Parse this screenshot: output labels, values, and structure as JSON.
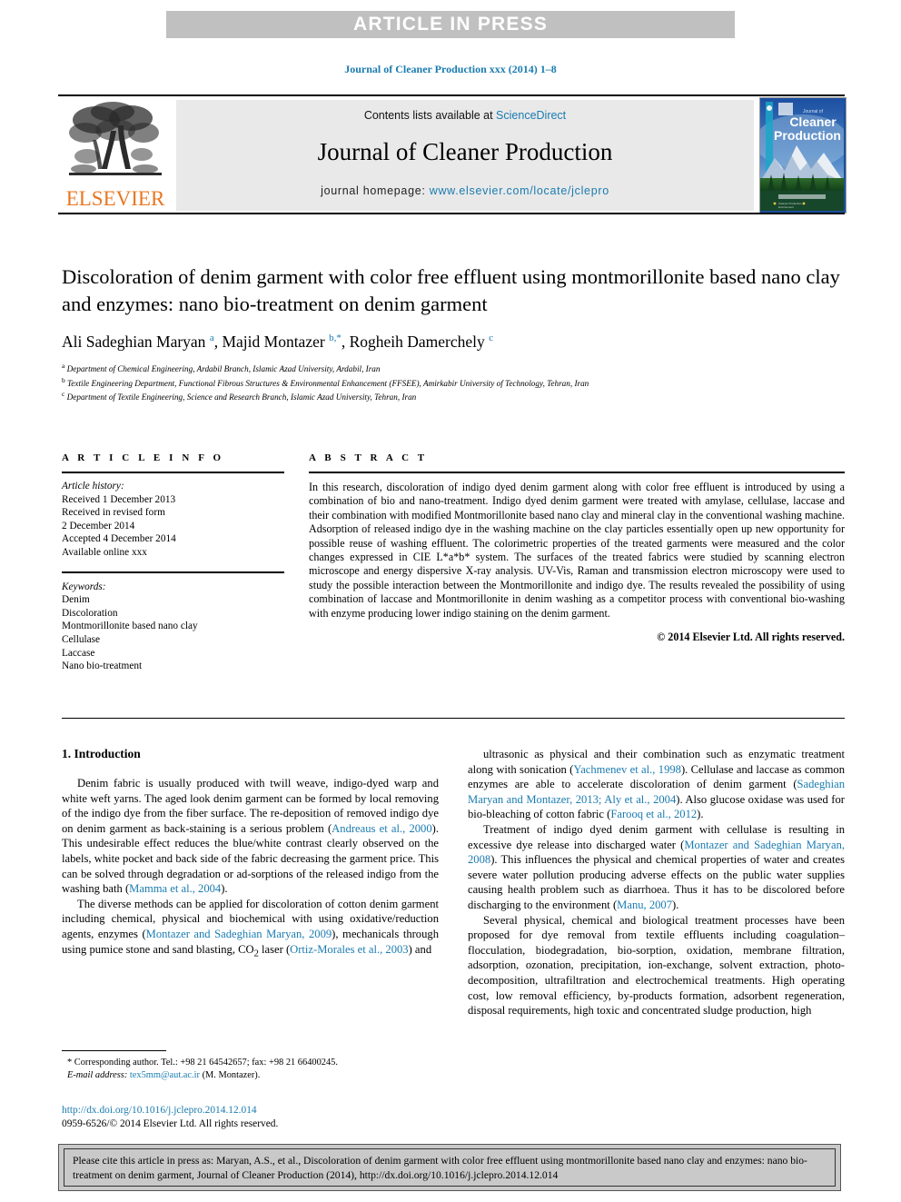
{
  "banner": {
    "text": "ARTICLE IN PRESS"
  },
  "running_head": "Journal of Cleaner Production xxx (2014) 1–8",
  "masthead": {
    "contents_prefix": "Contents lists available at ",
    "sciencedirect": "ScienceDirect",
    "journal_title": "Journal of Cleaner Production",
    "homepage_label": "journal homepage: ",
    "homepage_url": "www.elsevier.com/locate/jclepro",
    "publisher": "ELSEVIER",
    "cover_line1": "Journal of",
    "cover_line2": "Cleaner",
    "cover_line3": "Production",
    "accent_color": "#1a7bb0",
    "publisher_color": "#e87722"
  },
  "article": {
    "title": "Discoloration of denim garment with color free effluent using montmorillonite based nano clay and enzymes: nano bio-treatment on denim garment",
    "authors_html": "Ali Sadeghian Maryan <sup>a</sup>, Majid Montazer <sup>b,</sup><sup>*</sup>, Rogheih Damerchely <sup>c</sup>",
    "affiliations": [
      {
        "mark": "a",
        "text": "Department of Chemical Engineering, Ardabil Branch, Islamic Azad University, Ardabil, Iran"
      },
      {
        "mark": "b",
        "text": "Textile Engineering Department, Functional Fibrous Structures & Environmental Enhancement (FFSEE), Amirkabir University of Technology, Tehran, Iran"
      },
      {
        "mark": "c",
        "text": "Department of Textile Engineering, Science and Research Branch, Islamic Azad University, Tehran, Iran"
      }
    ]
  },
  "article_info": {
    "heading": "A R T I C L E  I N F O",
    "history_label": "Article history:",
    "history_lines": [
      "Received 1 December 2013",
      "Received in revised form",
      "2 December 2014",
      "Accepted 4 December 2014",
      "Available online xxx"
    ],
    "keywords_label": "Keywords:",
    "keywords": [
      "Denim",
      "Discoloration",
      "Montmorillonite based nano clay",
      "Cellulase",
      "Laccase",
      "Nano bio-treatment"
    ]
  },
  "abstract": {
    "heading": "A B S T R A C T",
    "text": "In this research, discoloration of indigo dyed denim garment along with color free effluent is introduced by using a combination of bio and nano-treatment. Indigo dyed denim garment were treated with amylase, cellulase, laccase and their combination with modified Montmorillonite based nano clay and mineral clay in the conventional washing machine. Adsorption of released indigo dye in the washing machine on the clay particles essentially open up new opportunity for possible reuse of washing effluent. The colorimetric properties of the treated garments were measured and the color changes expressed in CIE L*a*b* system. The surfaces of the treated fabrics were studied by scanning electron microscope and energy dispersive X-ray analysis. UV-Vis, Raman and transmission electron microscopy were used to study the possible interaction between the Montmorillonite and indigo dye. The results revealed the possibility of using combination of laccase and Montmorillonite in denim washing as a competitor process with conventional bio-washing with enzyme producing lower indigo staining on the denim garment.",
    "copyright": "© 2014 Elsevier Ltd. All rights reserved."
  },
  "introduction": {
    "section_number_title": "1. Introduction",
    "left_paragraphs": [
      "Denim fabric is usually produced with twill weave, indigo-dyed warp and white weft yarns. The aged look denim garment can be formed by local removing of the indigo dye from the fiber surface. The re-deposition of removed indigo dye on denim garment as back-staining is a serious problem (<span class=\"ref\" data-name=\"citation-link\" data-interactable=\"true\">Andreaus et al., 2000</span>). This undesirable effect reduces the blue/white contrast clearly observed on the labels, white pocket and back side of the fabric decreasing the garment price. This can be solved through degradation or ad-sorptions of the released indigo from the washing bath (<span class=\"ref\" data-name=\"citation-link\" data-interactable=\"true\">Mamma et al., 2004</span>).",
      "The diverse methods can be applied for discoloration of cotton denim garment including chemical, physical and biochemical with using oxidative/reduction agents, enzymes (<span class=\"ref\" data-name=\"citation-link\" data-interactable=\"true\">Montazer and Sadeghian Maryan, 2009</span>), mechanicals through using pumice stone and sand blasting, CO<sub>2</sub> laser (<span class=\"ref\" data-name=\"citation-link\" data-interactable=\"true\">Ortiz-Morales et al., 2003</span>) and"
    ],
    "right_paragraphs": [
      "ultrasonic as physical and their combination such as enzymatic treatment along with sonication (<span class=\"ref\" data-name=\"citation-link\" data-interactable=\"true\">Yachmenev et al., 1998</span>). Cellulase and laccase as common enzymes are able to accelerate discoloration of denim garment (<span class=\"ref\" data-name=\"citation-link\" data-interactable=\"true\">Sadeghian Maryan and Montazer, 2013; Aly et al., 2004</span>). Also glucose oxidase was used for bio-bleaching of cotton fabric (<span class=\"ref\" data-name=\"citation-link\" data-interactable=\"true\">Farooq et al., 2012</span>).",
      "Treatment of indigo dyed denim garment with cellulase is resulting in excessive dye release into discharged water (<span class=\"ref\" data-name=\"citation-link\" data-interactable=\"true\">Montazer and Sadeghian Maryan, 2008</span>). This influences the physical and chemical properties of water and creates severe water pollution producing adverse effects on the public water supplies causing health problem such as diarrhoea. Thus it has to be discolored before discharging to the environment (<span class=\"ref\" data-name=\"citation-link\" data-interactable=\"true\">Manu, 2007</span>).",
      "Several physical, chemical and biological treatment processes have been proposed for dye removal from textile effluents including coagulation–flocculation, biodegradation, bio-sorption, oxidation, membrane filtration, adsorption, ozonation, precipitation, ion-exchange, solvent extraction, photo-decomposition, ultrafiltration and electrochemical treatments. High operating cost, low removal efficiency, by-products formation, adsorbent regeneration, disposal requirements, high toxic and concentrated sludge production, high"
    ]
  },
  "footnote": {
    "corresponding": "* Corresponding author. Tel.: +98 21 64542657; fax: +98 21 66400245.",
    "email_label": "E-mail address:",
    "email": "tex5mm@aut.ac.ir",
    "email_owner": "(M. Montazer)."
  },
  "doi_block": {
    "doi_url": "http://dx.doi.org/10.1016/j.jclepro.2014.12.014",
    "issn_line": "0959-6526/© 2014 Elsevier Ltd. All rights reserved."
  },
  "citation_footer": {
    "text": "Please cite this article in press as: Maryan, A.S., et al., Discoloration of denim garment with color free effluent using montmorillonite based nano clay and enzymes: nano bio-treatment on denim garment, Journal of Cleaner Production (2014), http://dx.doi.org/10.1016/j.jclepro.2014.12.014"
  }
}
